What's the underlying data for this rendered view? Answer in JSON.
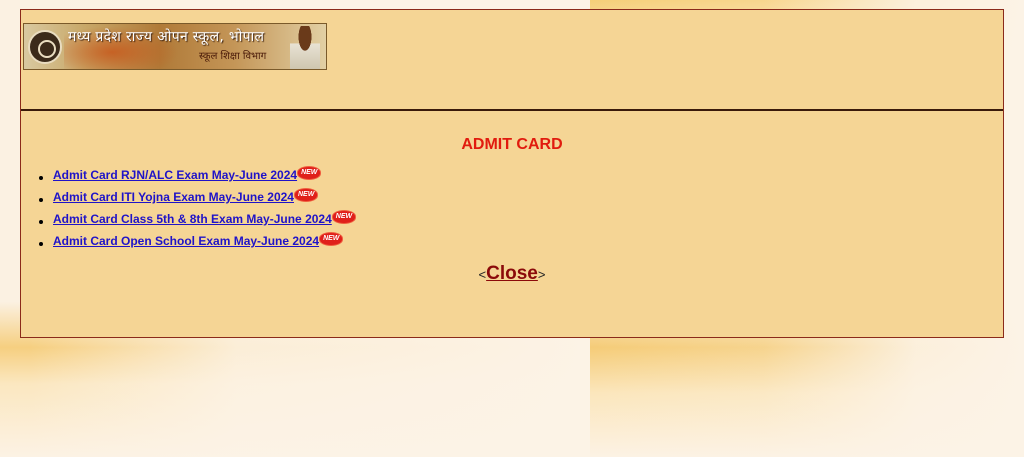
{
  "header": {
    "title_hindi": "मध्य प्रदेश राज्य ओपन स्कूल, भोपाल",
    "subtitle_hindi": "स्कूल शिक्षा विभाग"
  },
  "main": {
    "heading": "ADMIT CARD",
    "links": [
      {
        "label": "Admit Card RJN/ALC Exam May-June 2024",
        "badge": "NEW"
      },
      {
        "label": "Admit Card ITI Yojna Exam May-June 2024",
        "badge": "NEW"
      },
      {
        "label": "Admit Card Class 5th & 8th Exam May-June 2024",
        "badge": "NEW"
      },
      {
        "label": "Admit Card Open School Exam May-June 2024",
        "badge": "NEW"
      }
    ],
    "close": {
      "prefix": "<",
      "label": "Close",
      "suffix": ">"
    }
  },
  "colors": {
    "panel_bg": "#f5d595",
    "heading": "#e11b0e",
    "link": "#1f13c8",
    "close_link": "#8b0a0a",
    "border": "#8b2a1a"
  }
}
